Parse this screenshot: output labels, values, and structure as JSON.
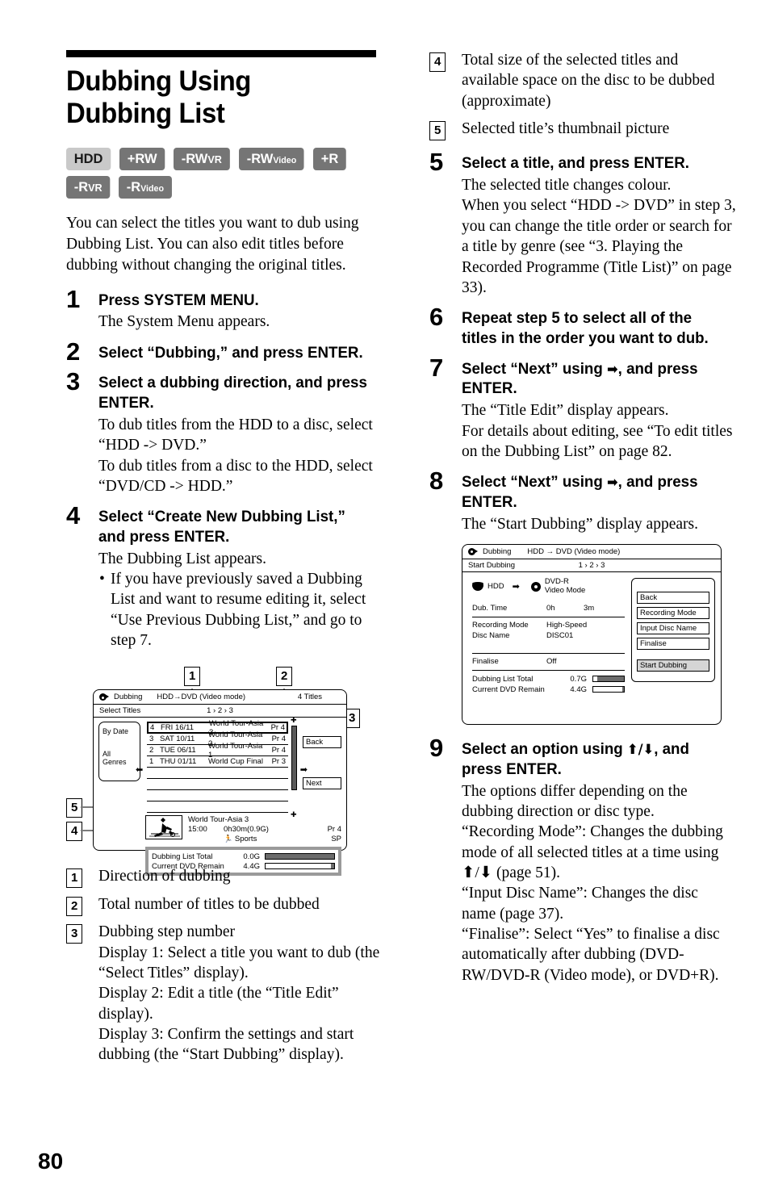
{
  "page": {
    "number": "80",
    "title": "Dubbing Using Dubbing List"
  },
  "media_badges": {
    "row1": [
      {
        "main": "HDD",
        "sub": "",
        "style": "light"
      },
      {
        "main": "+RW",
        "sub": "",
        "style": "dark"
      },
      {
        "main": "-RW",
        "sub": "VR",
        "style": "dark"
      },
      {
        "main": "-RW",
        "sub": "Video",
        "style": "dark"
      },
      {
        "main": "+R",
        "sub": "",
        "style": "dark"
      }
    ],
    "row2": [
      {
        "main": "-R",
        "sub": "VR",
        "style": "dark"
      },
      {
        "main": "-R",
        "sub": "Video",
        "style": "dark"
      }
    ]
  },
  "intro": "You can select the titles you want to dub using Dubbing List. You can also edit titles before dubbing without changing the original titles.",
  "steps": {
    "s1": {
      "num": "1",
      "head": "Press SYSTEM MENU.",
      "body": [
        "The System Menu appears."
      ]
    },
    "s2": {
      "num": "2",
      "head": "Select “Dubbing,” and press ENTER.",
      "body": []
    },
    "s3": {
      "num": "3",
      "head": "Select a dubbing direction, and press ENTER.",
      "body": [
        "To dub titles from the HDD to a disc, select “HDD -> DVD.”",
        "To dub titles from a disc to the HDD, select “DVD/CD -> HDD.”"
      ]
    },
    "s4": {
      "num": "4",
      "head": "Select “Create New Dubbing List,” and press ENTER.",
      "body": [
        "The Dubbing List appears."
      ],
      "bullet": "If you have previously saved a Dubbing List and want to resume editing it, select “Use Previous Dubbing List,” and go to step 7."
    },
    "s5": {
      "num": "5",
      "head": "Select a title, and press ENTER.",
      "body": [
        "The selected title changes colour.",
        "When you select “HDD -> DVD” in step 3, you can change the title order or search for a title by genre (see “3. Playing the Recorded Programme (Title List)” on page 33)."
      ]
    },
    "s6": {
      "num": "6",
      "head": "Repeat step 5 to select all of the titles in the order you want to dub.",
      "body": []
    },
    "s7": {
      "num": "7",
      "head_pre": "Select “Next” using",
      "head_arrow": "➡",
      "head_post": ", and press ENTER.",
      "body": [
        "The “Title Edit” display appears.",
        "For details about editing, see “To edit titles on the Dubbing List” on page 82."
      ]
    },
    "s8": {
      "num": "8",
      "head_pre": "Select “Next” using",
      "head_arrow": "➡",
      "head_post": ", and press ENTER.",
      "body": [
        "The “Start Dubbing” display appears."
      ]
    },
    "s9": {
      "num": "9",
      "head_pre": "Select an option using",
      "head_arrows": "⬆/⬇",
      "head_post": ", and press ENTER.",
      "body": [
        "The options differ depending on the dubbing direction or disc type.",
        "“Recording Mode”: Changes the dubbing mode of all selected titles at a time using ⬆/⬇ (page 51).",
        "“Input Disc Name”: Changes the disc name (page 37).",
        "“Finalise”: Select “Yes” to finalise a disc automatically after dubbing (DVD-RW/DVD-R (Video mode), or DVD+R)."
      ]
    }
  },
  "figure_select_titles": {
    "callouts": {
      "c1": "1",
      "c2": "2",
      "c3": "3",
      "c4": "4",
      "c5": "5"
    },
    "titlebar": {
      "app": "Dubbing",
      "direction": "HDD→DVD (Video mode)",
      "count": "4 Titles"
    },
    "steprow": {
      "label": "Select Titles",
      "steps": "1 › 2 › 3"
    },
    "genre": {
      "by_date": "By Date",
      "all_genres": "All Genres"
    },
    "titles": [
      {
        "no": "4",
        "date": "FRI  16/11",
        "name": "World Tour-Asia 3",
        "pr": "Pr 4",
        "selected": true
      },
      {
        "no": "3",
        "date": "SAT 10/11",
        "name": "World Tour-Asia 2",
        "pr": "Pr 4",
        "selected": false
      },
      {
        "no": "2",
        "date": "TUE 06/11",
        "name": "World Tour-Asia 1",
        "pr": "Pr 4",
        "selected": false
      },
      {
        "no": "1",
        "date": "THU 01/11",
        "name": "World Cup Final",
        "pr": "Pr 3",
        "selected": false
      }
    ],
    "buttons": {
      "back": "Back",
      "next": "Next"
    },
    "preview": {
      "name": "World Tour-Asia 3",
      "time": "15:00",
      "size": "0h30m(0.9G)",
      "genre": "Sports",
      "pr": "Pr 4",
      "mode": "SP"
    },
    "totals": [
      {
        "label": "Dubbing List Total",
        "value": "0.0G",
        "fill_pct": 100
      },
      {
        "label": "Current DVD Remain",
        "value": "4.4G",
        "fill_pct": 0
      }
    ]
  },
  "figure_start_dubbing": {
    "titlebar": {
      "app": "Dubbing",
      "direction": "HDD → DVD (Video mode)"
    },
    "steprow": {
      "label": "Start Dubbing",
      "steps": "1 › 2 › 3"
    },
    "source": "HDD",
    "target_line1": "DVD-R",
    "target_line2": "Video Mode",
    "fields": [
      {
        "key": "Dub. Time",
        "value": "0h",
        "value2": "3m"
      },
      {
        "key": "Recording Mode",
        "value": "High-Speed",
        "value2": ""
      },
      {
        "key": "Disc Name",
        "value": "DISC01",
        "value2": ""
      },
      {
        "key": "Finalise",
        "value": "Off",
        "value2": ""
      }
    ],
    "buttons": [
      {
        "label": "Back",
        "shaded": false
      },
      {
        "label": "Recording Mode",
        "shaded": false
      },
      {
        "label": "Input Disc Name",
        "shaded": false
      },
      {
        "label": "Finalise",
        "shaded": false
      },
      {
        "label": "Start Dubbing",
        "shaded": true
      }
    ],
    "totals": [
      {
        "label": "Dubbing List Total",
        "value": "0.7G",
        "fill_pct": 88
      },
      {
        "label": "Current DVD Remain",
        "value": "4.4G",
        "fill_pct": 0
      }
    ]
  },
  "legend": {
    "items": [
      {
        "num": "1",
        "text": "Direction of dubbing",
        "subs": []
      },
      {
        "num": "2",
        "text": "Total number of titles to be dubbed",
        "subs": []
      },
      {
        "num": "3",
        "text": "Dubbing step number",
        "subs": [
          "Display 1: Select a title you want to dub (the “Select Titles” display).",
          "Display 2: Edit a title (the “Title Edit” display).",
          "Display 3: Confirm the settings and start dubbing (the “Start Dubbing” display)."
        ]
      },
      {
        "num": "4",
        "text": "Total size of the selected titles and available space on the disc to be dubbed (approximate)",
        "subs": []
      },
      {
        "num": "5",
        "text": "Selected title’s thumbnail picture",
        "subs": []
      }
    ]
  }
}
